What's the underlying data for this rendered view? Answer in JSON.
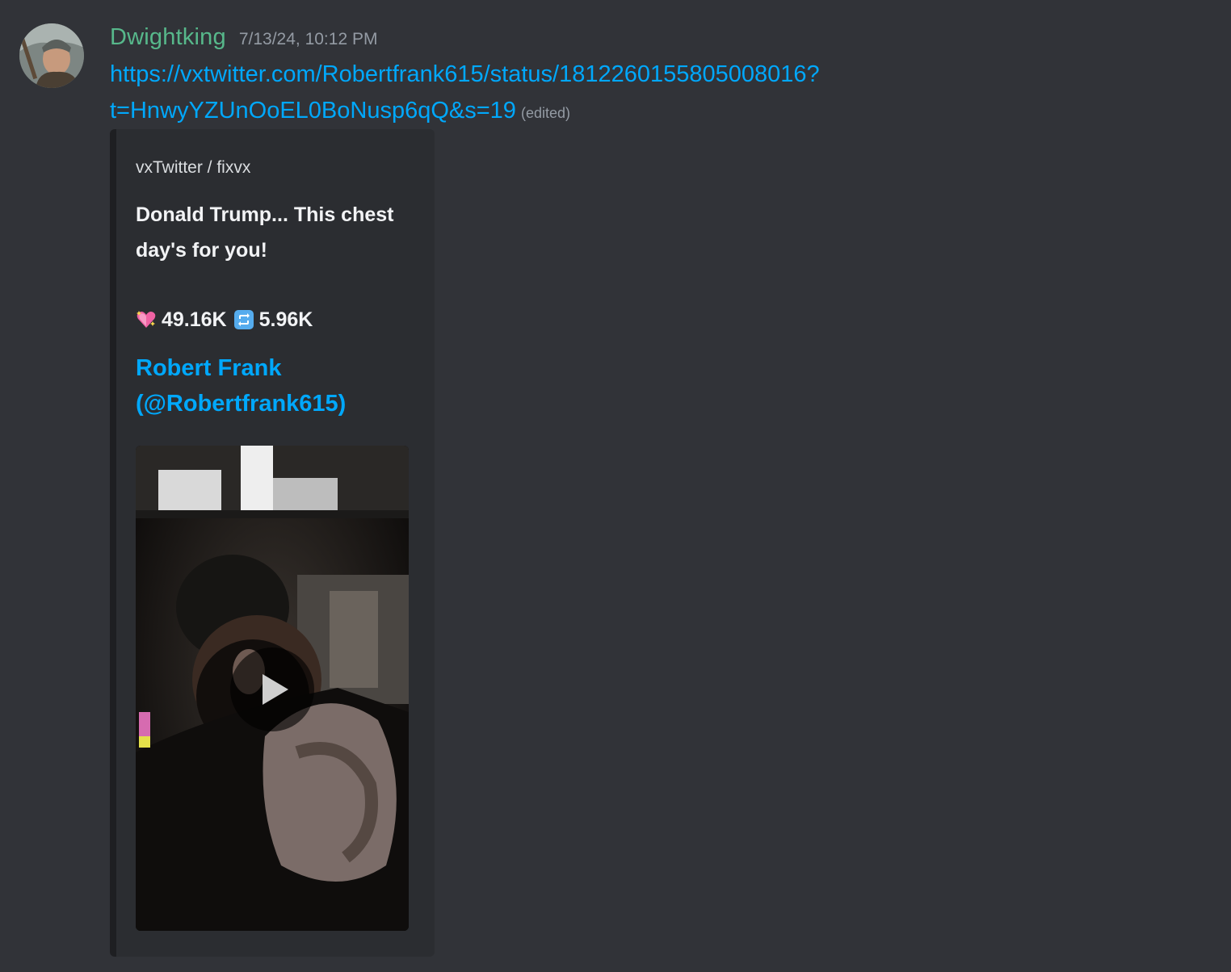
{
  "message": {
    "author": {
      "username": "Dwightking",
      "username_color": "#57b88b",
      "avatar_icon": "avatar-image"
    },
    "timestamp": "7/13/24, 10:12 PM",
    "link_line1": "https://vxtwitter.com/Robertfrank615/status/1812260155805008016?",
    "link_line2": "t=HnwyYZUnOoEL0BoNusp6qQ&s=19",
    "edited_label": "(edited)"
  },
  "embed": {
    "provider": "vxTwitter / fixvx",
    "description_line1": "Donald Trump... This chest",
    "description_line2": "day's for you!",
    "likes_icon": "sparkling-heart-icon",
    "likes": "49.16K",
    "retweets_icon": "repeat-icon",
    "retweets": "5.96K",
    "author_name": "Robert Frank",
    "author_handle": "(@Robertfrank615)",
    "video_control_icon": "play-icon"
  },
  "colors": {
    "background": "#313338",
    "embed_background": "#2b2d31",
    "link": "#00a8fc",
    "muted_text": "#949ba4"
  }
}
